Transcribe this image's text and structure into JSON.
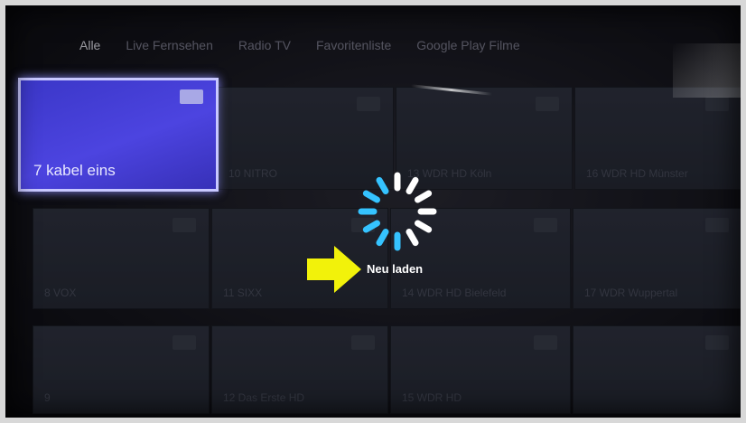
{
  "tabs": [
    {
      "label": "Alle",
      "active": true
    },
    {
      "label": "Live Fernsehen",
      "active": false
    },
    {
      "label": "Radio TV",
      "active": false
    },
    {
      "label": "Favoritenliste",
      "active": false
    },
    {
      "label": "Google Play Filme",
      "active": false
    }
  ],
  "channels": [
    {
      "label": "7 kabel eins",
      "focused": true
    },
    {
      "label": "10 NITRO"
    },
    {
      "label": "13 WDR HD Köln"
    },
    {
      "label": "16 WDR HD Münster"
    },
    {
      "label": "8 VOX"
    },
    {
      "label": "11 SIXX"
    },
    {
      "label": "14 WDR HD Bielefeld"
    },
    {
      "label": "17 WDR Wuppertal"
    },
    {
      "label": "9"
    },
    {
      "label": "12 Das Erste HD"
    },
    {
      "label": "15 WDR HD"
    },
    {
      "label": ""
    }
  ],
  "loading": {
    "label": "Neu laden"
  },
  "colors": {
    "focus_tile": "#4c44e0",
    "spinner": "#35c3ff",
    "arrow": "#f2f20a"
  },
  "icons": {
    "tile_badge": "tv-badge-icon",
    "spinner": "loading-spinner-icon",
    "arrow": "arrow-right-icon"
  }
}
